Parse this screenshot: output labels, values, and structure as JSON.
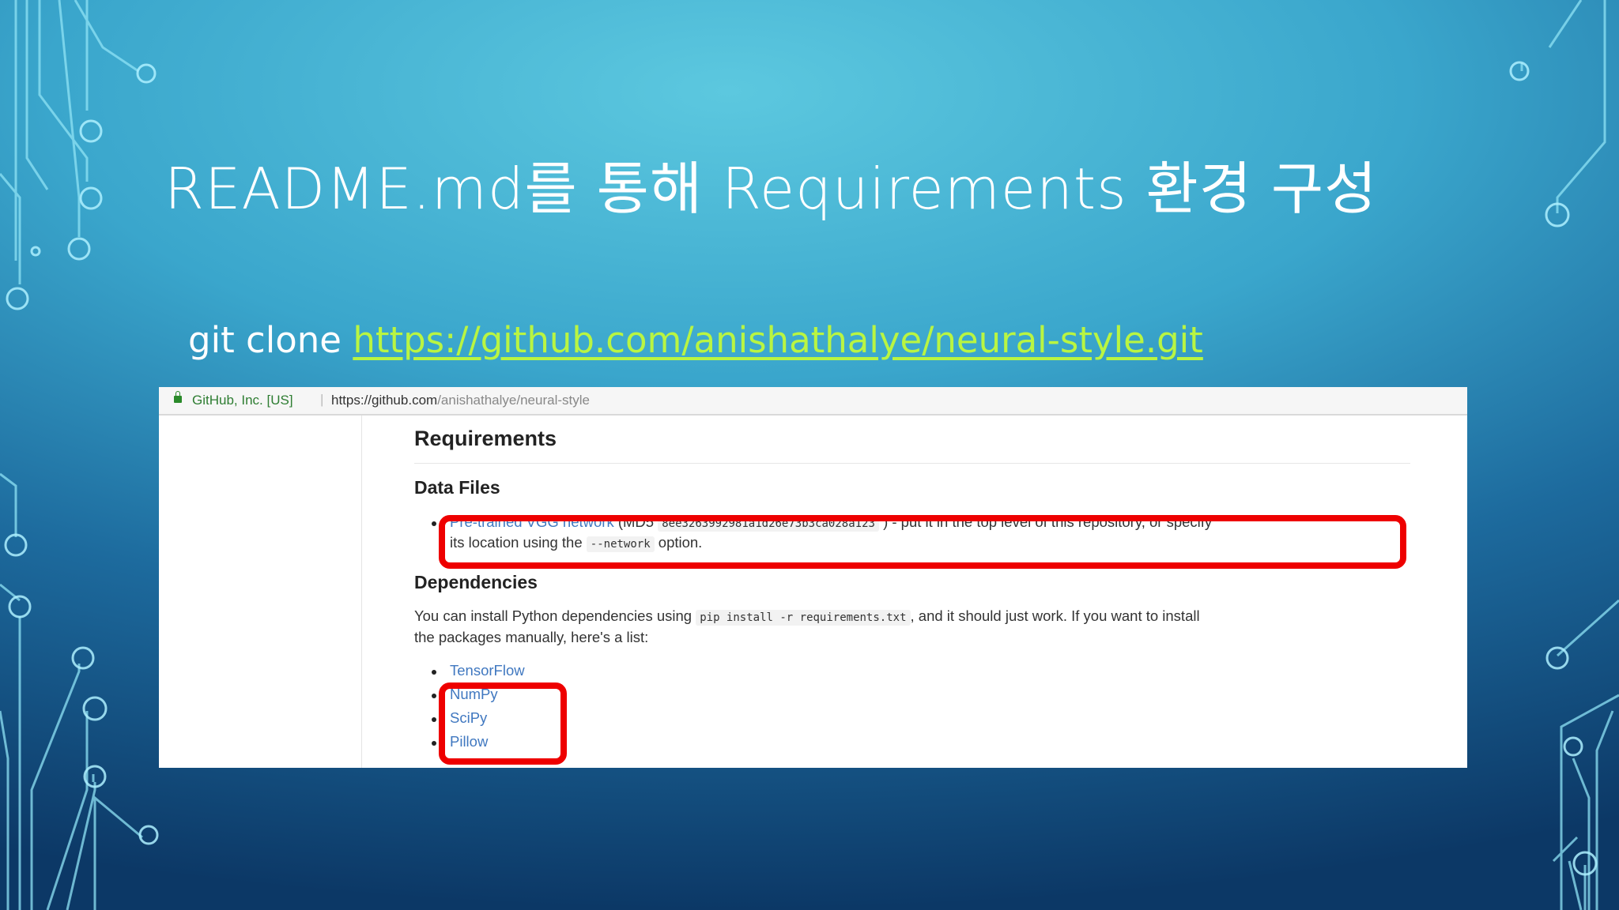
{
  "slide": {
    "title": "README.md를 통해 Requirements 환경 구성",
    "clone_prefix": "git clone",
    "clone_url": "https://github.com/anishathalye/neural-style.git"
  },
  "colors": {
    "link_green": "#b9f542",
    "highlight_red": "#ee0000",
    "github_link": "#4078c0"
  },
  "browser": {
    "site_identity": "GitHub, Inc. [US]",
    "url_host": "https://github.com",
    "url_path": "/anishathalye/neural-style"
  },
  "readme": {
    "heading": "Requirements",
    "data_files": {
      "heading": "Data Files",
      "link": "Pre-trained VGG network",
      "md5_label": "(MD5",
      "md5": "8ee3263992981a1d26e73b3ca028a123",
      "rest_line1": ") - put it in the top level of this repository, or specify",
      "line2_prefix": "its location using the",
      "option_code": "--network",
      "line2_suffix": "option."
    },
    "dependencies": {
      "heading": "Dependencies",
      "line1_prefix": "You can install Python dependencies using",
      "pip_code": "pip install -r requirements.txt",
      "line1_suffix": ", and it should just work. If you want to install",
      "line2": "the packages manually, here's a list:",
      "packages": [
        "TensorFlow",
        "NumPy",
        "SciPy",
        "Pillow"
      ]
    }
  }
}
